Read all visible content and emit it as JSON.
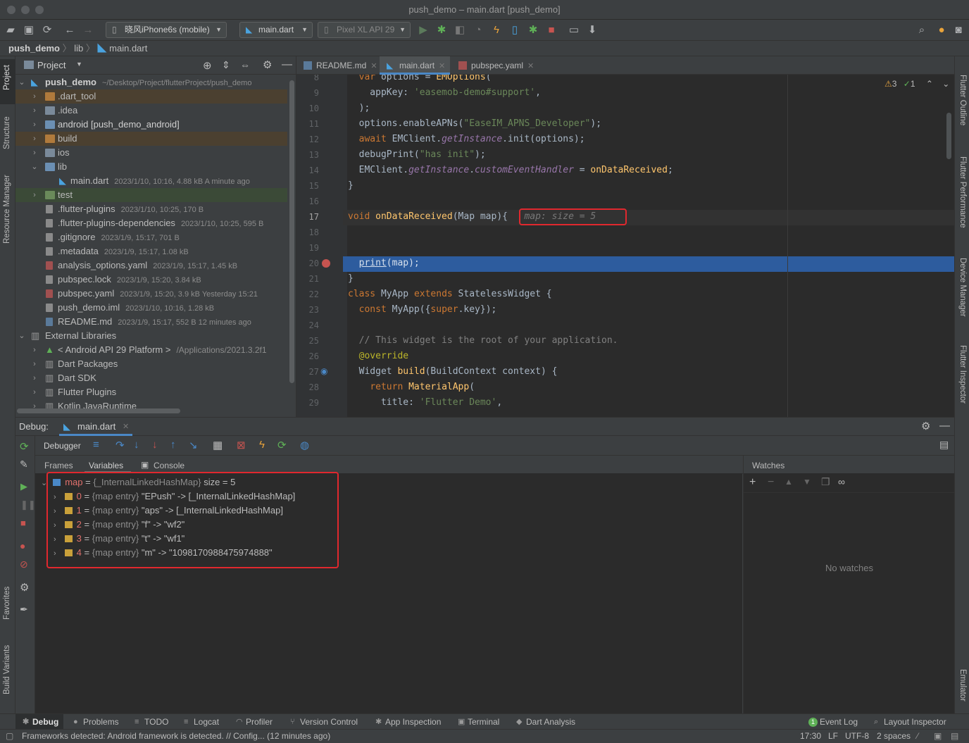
{
  "window": {
    "title": "push_demo – main.dart [push_demo]"
  },
  "toolbar": {
    "device": "晓风iPhone6s (mobile)",
    "run_config": "main.dart",
    "emulator": "Pixel XL API 29"
  },
  "breadcrumb": [
    "push_demo",
    "lib",
    "main.dart"
  ],
  "left_strip": [
    "Project",
    "Structure",
    "Resource Manager",
    "Favorites",
    "Build Variants"
  ],
  "right_strip": [
    "Flutter Outline",
    "Flutter Performance",
    "Device Manager",
    "Flutter Inspector",
    "Emulator"
  ],
  "project": {
    "header": "Project",
    "root": {
      "name": "push_demo",
      "path": "~/Desktop/Project/flutterProject/push_demo"
    },
    "items": [
      {
        "name": ".dart_tool",
        "meta": ""
      },
      {
        "name": ".idea",
        "meta": ""
      },
      {
        "name": "android [push_demo_android]",
        "meta": ""
      },
      {
        "name": "build",
        "meta": ""
      },
      {
        "name": "ios",
        "meta": ""
      },
      {
        "name": "lib",
        "meta": ""
      },
      {
        "name": "main.dart",
        "meta": "2023/1/10, 10:16, 4.88 kB A minute ago"
      },
      {
        "name": "test",
        "meta": ""
      },
      {
        "name": ".flutter-plugins",
        "meta": "2023/1/10, 10:25, 170 B"
      },
      {
        "name": ".flutter-plugins-dependencies",
        "meta": "2023/1/10, 10:25, 595 B"
      },
      {
        "name": ".gitignore",
        "meta": "2023/1/9, 15:17, 701 B"
      },
      {
        "name": ".metadata",
        "meta": "2023/1/9, 15:17, 1.08 kB"
      },
      {
        "name": "analysis_options.yaml",
        "meta": "2023/1/9, 15:17, 1.45 kB"
      },
      {
        "name": "pubspec.lock",
        "meta": "2023/1/9, 15:20, 3.84 kB"
      },
      {
        "name": "pubspec.yaml",
        "meta": "2023/1/9, 15:20, 3.9 kB Yesterday 15:21"
      },
      {
        "name": "push_demo.iml",
        "meta": "2023/1/10, 10:16, 1.28 kB"
      },
      {
        "name": "README.md",
        "meta": "2023/1/9, 15:17, 552 B 12 minutes ago"
      },
      {
        "name": "External Libraries",
        "meta": ""
      },
      {
        "name": "< Android API 29 Platform >",
        "meta": "/Applications/2021.3.2f1"
      },
      {
        "name": "Dart Packages",
        "meta": ""
      },
      {
        "name": "Dart SDK",
        "meta": ""
      },
      {
        "name": "Flutter Plugins",
        "meta": ""
      },
      {
        "name": "Kotlin JavaRuntime",
        "meta": ""
      }
    ]
  },
  "editor": {
    "tabs": [
      "README.md",
      "main.dart",
      "pubspec.yaml"
    ],
    "inspections": {
      "warnings": "3",
      "ok": "1"
    },
    "inline_hint": "map: size = 5",
    "line_numbers": [
      "8",
      "9",
      "10",
      "11",
      "12",
      "13",
      "14",
      "15",
      "16",
      "17",
      "18",
      "19",
      "20",
      "21",
      "22",
      "23",
      "24",
      "25",
      "26",
      "27",
      "28",
      "29"
    ]
  },
  "debug": {
    "title": "Debug:",
    "session": "main.dart",
    "debugger_label": "Debugger",
    "tabs": [
      "Frames",
      "Variables",
      "Console"
    ],
    "watches_title": "Watches",
    "no_watches": "No watches",
    "variables": {
      "root": {
        "name": "map",
        "eq": " = ",
        "type": "{_InternalLinkedHashMap}",
        "value": " size = 5"
      },
      "entries": [
        {
          "key": "0",
          "type": "{map entry}",
          "value": " \"EPush\" -> [_InternalLinkedHashMap]"
        },
        {
          "key": "1",
          "type": "{map entry}",
          "value": " \"aps\" -> [_InternalLinkedHashMap]"
        },
        {
          "key": "2",
          "type": "{map entry}",
          "value": " \"f\" -> \"wf2\""
        },
        {
          "key": "3",
          "type": "{map entry}",
          "value": " \"t\" -> \"wf1\""
        },
        {
          "key": "4",
          "type": "{map entry}",
          "value": " \"m\" -> \"1098170988475974888\""
        }
      ]
    }
  },
  "bottom_tabs": [
    "Debug",
    "Problems",
    "TODO",
    "Logcat",
    "Profiler",
    "Version Control",
    "App Inspection",
    "Terminal",
    "Dart Analysis"
  ],
  "bottom_right": [
    "Event Log",
    "Layout Inspector"
  ],
  "event_log_count": "1",
  "status": {
    "message": "Frameworks detected: Android framework is detected. // Config... (12 minutes ago)",
    "position": "17:30",
    "line_sep": "LF",
    "encoding": "UTF-8",
    "indent": "2 spaces"
  },
  "colors": {
    "selection": "#2d5c9e",
    "breakpoint": "#c75450",
    "highlight": "#e0282e",
    "accent": "#3592c4"
  }
}
